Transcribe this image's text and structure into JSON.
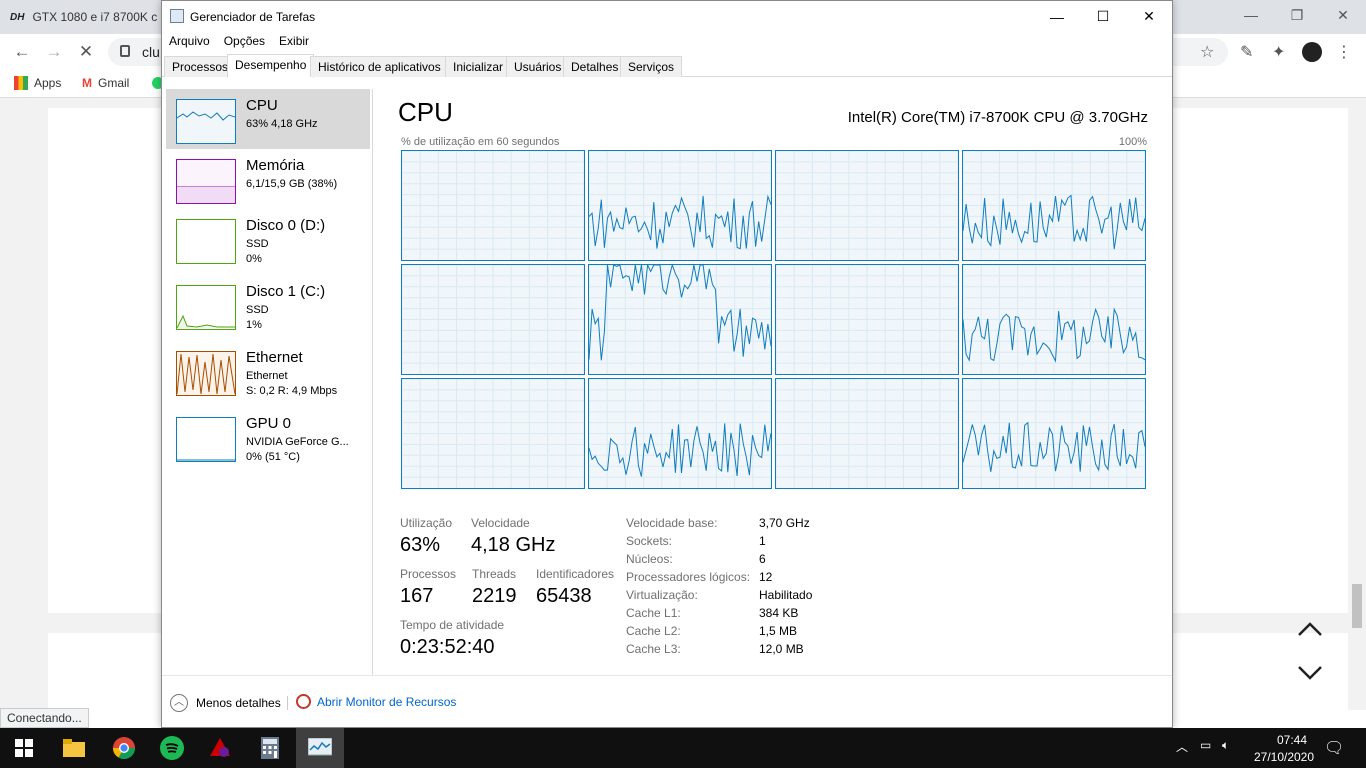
{
  "browser": {
    "tab_title": "GTX 1080 e i7 8700K c",
    "tab_fav": "DH",
    "address_text": "clu",
    "bookmarks": [
      "Apps",
      "Gmail"
    ],
    "status_text": "Conectando..."
  },
  "taskmgr": {
    "title": "Gerenciador de Tarefas",
    "menu": [
      "Arquivo",
      "Opções",
      "Exibir"
    ],
    "tabs": [
      "Processos",
      "Desempenho",
      "Histórico de aplicativos",
      "Inicializar",
      "Usuários",
      "Detalhes",
      "Serviços"
    ],
    "active_tab": "Desempenho",
    "sidebar": [
      {
        "name": "CPU",
        "sub1": "63% 4,18 GHz",
        "sub2": "",
        "sub3": "",
        "color": "#117dbb"
      },
      {
        "name": "Memória",
        "sub1": "6,1/15,9 GB (38%)",
        "sub2": "",
        "sub3": "",
        "color": "#8b12ae"
      },
      {
        "name": "Disco 0 (D:)",
        "sub1": "SSD",
        "sub2": "0%",
        "sub3": "",
        "color": "#4da60c"
      },
      {
        "name": "Disco 1 (C:)",
        "sub1": "SSD",
        "sub2": "1%",
        "sub3": "",
        "color": "#4da60c"
      },
      {
        "name": "Ethernet",
        "sub1": "Ethernet",
        "sub2": "S: 0,2  R: 4,9 Mbps",
        "sub3": "",
        "color": "#a74f01"
      },
      {
        "name": "GPU 0",
        "sub1": "NVIDIA GeForce G...",
        "sub2": "0% (51 °C)",
        "sub3": "",
        "color": "#117dbb"
      }
    ],
    "main": {
      "title": "CPU",
      "cpu_model": "Intel(R) Core(TM) i7-8700K CPU @ 3.70GHz",
      "graph_caption": "% de utilização em 60 segundos",
      "graph_max": "100%",
      "stats": {
        "util_label": "Utilização",
        "util_value": "63%",
        "speed_label": "Velocidade",
        "speed_value": "4,18 GHz",
        "proc_label": "Processos",
        "proc_value": "167",
        "threads_label": "Threads",
        "threads_value": "2219",
        "handles_label": "Identificadores",
        "handles_value": "65438",
        "uptime_label": "Tempo de atividade",
        "uptime_value": "0:23:52:40"
      },
      "specs": [
        {
          "k": "Velocidade base:",
          "v": "3,70 GHz"
        },
        {
          "k": "Sockets:",
          "v": "1"
        },
        {
          "k": "Núcleos:",
          "v": "6"
        },
        {
          "k": "Processadores lógicos:",
          "v": "12"
        },
        {
          "k": "Virtualização:",
          "v": "Habilitado"
        },
        {
          "k": "Cache L1:",
          "v": "384 KB"
        },
        {
          "k": "Cache L2:",
          "v": "1,5 MB"
        },
        {
          "k": "Cache L3:",
          "v": "12,0 MB"
        }
      ]
    },
    "footer": {
      "less_details": "Menos detalhes",
      "resource_monitor": "Abrir Monitor de Recursos"
    }
  },
  "taskbar": {
    "time": "07:44",
    "date": "27/10/2020"
  }
}
